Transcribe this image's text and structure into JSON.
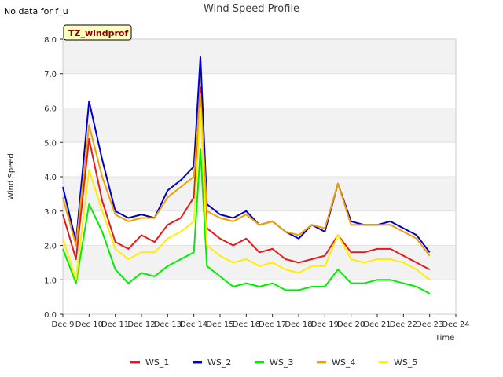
{
  "chart_data": {
    "type": "line",
    "title": "Wind Speed Profile",
    "annotation_top_left": "No data for f_u",
    "site_badge": "TZ_windprof",
    "xlabel": "Time",
    "ylabel": "Wind Speed",
    "ylim": [
      0.0,
      8.0
    ],
    "yticks": [
      "0.0",
      "1.0",
      "2.0",
      "3.0",
      "4.0",
      "5.0",
      "6.0",
      "7.0",
      "8.0"
    ],
    "xlim": [
      9,
      24
    ],
    "xticks": [
      "Dec 9",
      "Dec 10",
      "Dec 11",
      "Dec 12",
      "Dec 13",
      "Dec 14",
      "Dec 15",
      "Dec 16",
      "Dec 17",
      "Dec 18",
      "Dec 19",
      "Dec 20",
      "Dec 21",
      "Dec 22",
      "Dec 23",
      "Dec 24"
    ],
    "x": [
      9.0,
      9.5,
      10.0,
      10.5,
      11.0,
      11.5,
      12.0,
      12.5,
      13.0,
      13.5,
      14.0,
      14.25,
      14.5,
      15.0,
      15.5,
      16.0,
      16.5,
      17.0,
      17.5,
      18.0,
      18.5,
      19.0,
      19.5,
      20.0,
      20.5,
      21.0,
      21.5,
      22.0,
      22.5,
      23.0
    ],
    "grid": true,
    "legend_position": "bottom",
    "series": [
      {
        "name": "WS_1",
        "color": "#e41a1c",
        "values": [
          2.9,
          1.6,
          5.1,
          3.3,
          2.1,
          1.9,
          2.3,
          2.1,
          2.6,
          2.8,
          3.4,
          6.6,
          2.5,
          2.2,
          2.0,
          2.2,
          1.8,
          1.9,
          1.6,
          1.5,
          1.6,
          1.7,
          2.3,
          1.8,
          1.8,
          1.9,
          1.9,
          1.7,
          1.5,
          1.3
        ]
      },
      {
        "name": "WS_2",
        "color": "#0000cc",
        "values": [
          3.7,
          2.1,
          6.2,
          4.5,
          3.0,
          2.8,
          2.9,
          2.8,
          3.6,
          3.9,
          4.3,
          7.5,
          3.2,
          2.9,
          2.8,
          3.0,
          2.6,
          2.7,
          2.4,
          2.2,
          2.6,
          2.4,
          3.8,
          2.7,
          2.6,
          2.6,
          2.7,
          2.5,
          2.3,
          1.8
        ]
      },
      {
        "name": "WS_3",
        "color": "#00ee00",
        "values": [
          1.9,
          0.9,
          3.2,
          2.4,
          1.3,
          0.9,
          1.2,
          1.1,
          1.4,
          1.6,
          1.8,
          4.8,
          1.4,
          1.1,
          0.8,
          0.9,
          0.8,
          0.9,
          0.7,
          0.7,
          0.8,
          0.8,
          1.3,
          0.9,
          0.9,
          1.0,
          1.0,
          0.9,
          0.8,
          0.6
        ]
      },
      {
        "name": "WS_4",
        "color": "#f0a000",
        "values": [
          3.4,
          2.0,
          5.5,
          4.0,
          2.9,
          2.7,
          2.8,
          2.8,
          3.4,
          3.7,
          4.0,
          6.4,
          3.0,
          2.8,
          2.7,
          2.9,
          2.6,
          2.7,
          2.4,
          2.3,
          2.6,
          2.5,
          3.8,
          2.6,
          2.6,
          2.6,
          2.6,
          2.4,
          2.2,
          1.7
        ]
      },
      {
        "name": "WS_5",
        "color": "#ffee00",
        "values": [
          2.2,
          1.0,
          4.2,
          3.0,
          1.9,
          1.6,
          1.8,
          1.8,
          2.2,
          2.4,
          2.7,
          6.0,
          2.0,
          1.7,
          1.5,
          1.6,
          1.4,
          1.5,
          1.3,
          1.2,
          1.4,
          1.4,
          2.3,
          1.6,
          1.5,
          1.6,
          1.6,
          1.5,
          1.3,
          1.0
        ]
      }
    ]
  }
}
